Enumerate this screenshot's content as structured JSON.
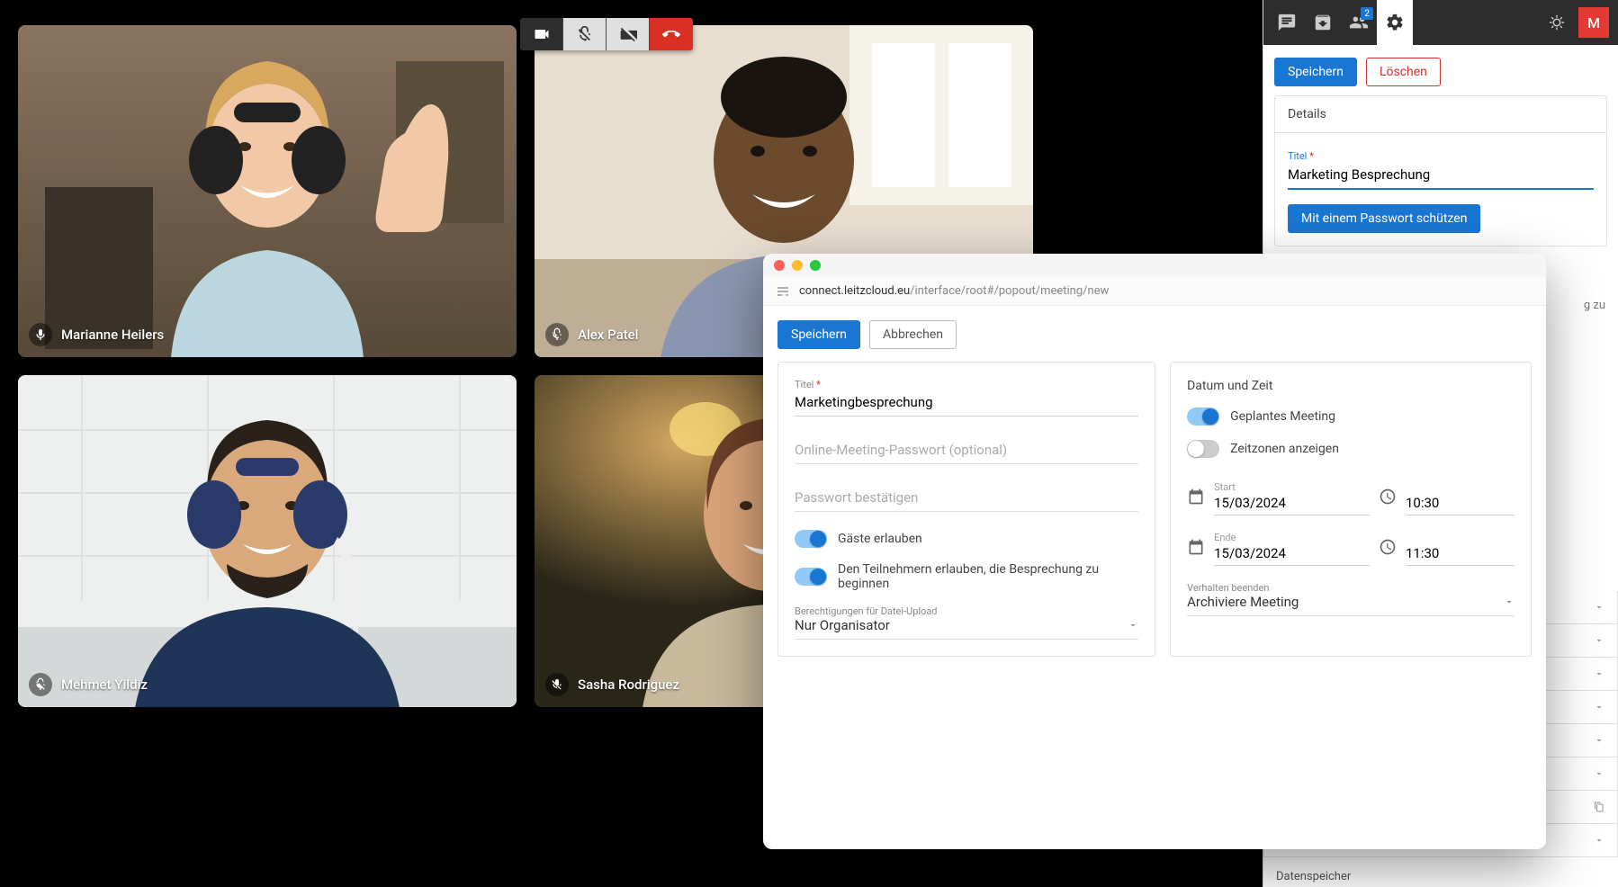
{
  "participants": [
    {
      "name": "Marianne Heilers",
      "muted": false
    },
    {
      "name": "Alex Patel",
      "muted": true
    },
    {
      "name": "Mehmet Yildiz",
      "muted": true
    },
    {
      "name": "Sasha Rodriguez",
      "muted": true
    }
  ],
  "sidebar": {
    "participants_badge": "2",
    "avatar_initial": "M",
    "save": "Speichern",
    "delete": "Löschen",
    "details_title": "Details",
    "title_label": "Titel",
    "title_value": "Marketing Besprechung",
    "protect_btn": "Mit einem Passwort schützen",
    "peek_text": "g zu",
    "storage": "Datenspeicher"
  },
  "popup": {
    "url_host": "connect.leitzcloud.eu",
    "url_path": "/interface/root#/popout/meeting/new",
    "save": "Speichern",
    "cancel": "Abbrechen",
    "left": {
      "title_label": "Titel",
      "title_value": "Marketingbesprechung",
      "password_placeholder": "Online-Meeting-Passwort (optional)",
      "password_confirm_placeholder": "Passwort bestätigen",
      "allow_guests": "Gäste erlauben",
      "allow_start": "Den Teilnehmern erlauben, die Besprechung zu beginnen",
      "upload_perm_label": "Berechtigungen für Datei-Upload",
      "upload_perm_value": "Nur Organisator"
    },
    "right": {
      "title": "Datum und Zeit",
      "scheduled": "Geplantes Meeting",
      "show_tz": "Zeitzonen anzeigen",
      "start_label": "Start",
      "start_date": "15/03/2024",
      "start_time": "10:30",
      "end_label": "Ende",
      "end_date": "15/03/2024",
      "end_time": "11:30",
      "end_behavior_label": "Verhalten beenden",
      "end_behavior_value": "Archiviere Meeting"
    }
  }
}
